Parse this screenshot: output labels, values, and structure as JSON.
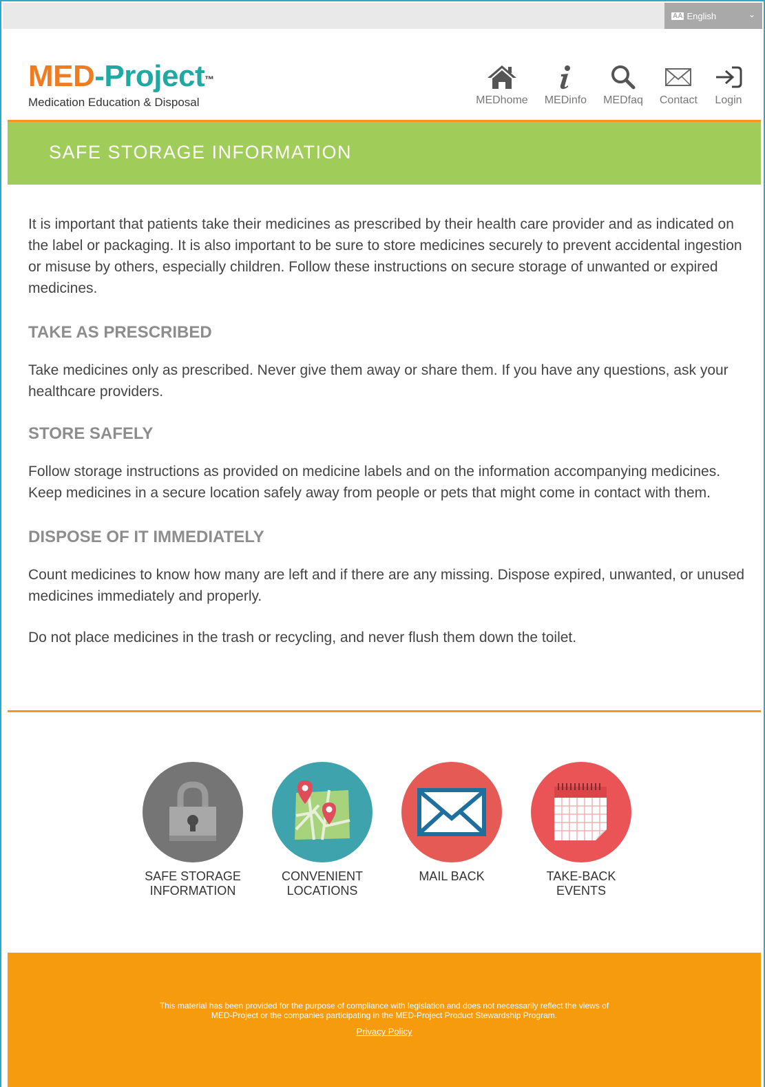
{
  "language": {
    "selected": "English",
    "flag_glyph": "ÀÁ"
  },
  "logo": {
    "part1": "MED",
    "part2": "-Project",
    "tm": "™",
    "subtitle": "Medication Education & Disposal"
  },
  "nav": [
    {
      "label": "MEDhome",
      "icon": "home-icon"
    },
    {
      "label": "MEDinfo",
      "icon": "info-icon"
    },
    {
      "label": "MEDfaq",
      "icon": "search-icon"
    },
    {
      "label": "Contact",
      "icon": "envelope-icon"
    },
    {
      "label": "Login",
      "icon": "login-arrow-icon"
    }
  ],
  "banner": {
    "title": "SAFE STORAGE INFORMATION"
  },
  "main": {
    "intro": "It is important that patients take their medicines as prescribed by their health care provider and as indicated on the label or packaging. It is also important to be sure to store medicines securely to prevent accidental ingestion or misuse by others, especially children. Follow these instructions on secure storage of unwanted or expired medicines.",
    "sections": [
      {
        "heading": "TAKE AS PRESCRIBED",
        "body": "Take medicines only as prescribed. Never give them away or share them. If you have any questions, ask your healthcare providers."
      },
      {
        "heading": "STORE SAFELY",
        "body": "Follow storage instructions as provided on medicine labels and on the information accompanying medicines. Keep medicines in a secure location safely away from people or pets that might come in contact with them."
      },
      {
        "heading": "DISPOSE OF IT IMMEDIATELY",
        "body": "Count medicines to know how many are left and if there are any missing. Dispose expired, unwanted, or unused medicines immediately and properly."
      }
    ],
    "closing": "Do not place medicines in the trash or recycling, and never flush them down the toilet."
  },
  "tiles": [
    {
      "line1": "SAFE STORAGE",
      "line2": "INFORMATION",
      "icon": "padlock-icon",
      "color": "#757575"
    },
    {
      "line1": "CONVENIENT",
      "line2": "LOCATIONS",
      "icon": "map-icon",
      "color": "#3ea3ad"
    },
    {
      "line1": "MAIL BACK",
      "line2": "",
      "icon": "mail-icon",
      "color": "#e55a55"
    },
    {
      "line1": "TAKE-BACK",
      "line2": "EVENTS",
      "icon": "calendar-icon",
      "color": "#ea5456"
    }
  ],
  "footer": {
    "disclaimer_line1": "This material has been provided for the purpose of compliance with legislation and does not necessarily reflect the views of",
    "disclaimer_line2": "MED-Project or the companies participating in the MED-Project Product Stewardship Program.",
    "privacy_link": "Privacy Policy"
  },
  "colors": {
    "orange": "#f5961f",
    "teal": "#1fa9a2",
    "green": "#a0cd5a",
    "footer": "#f79b0e"
  }
}
